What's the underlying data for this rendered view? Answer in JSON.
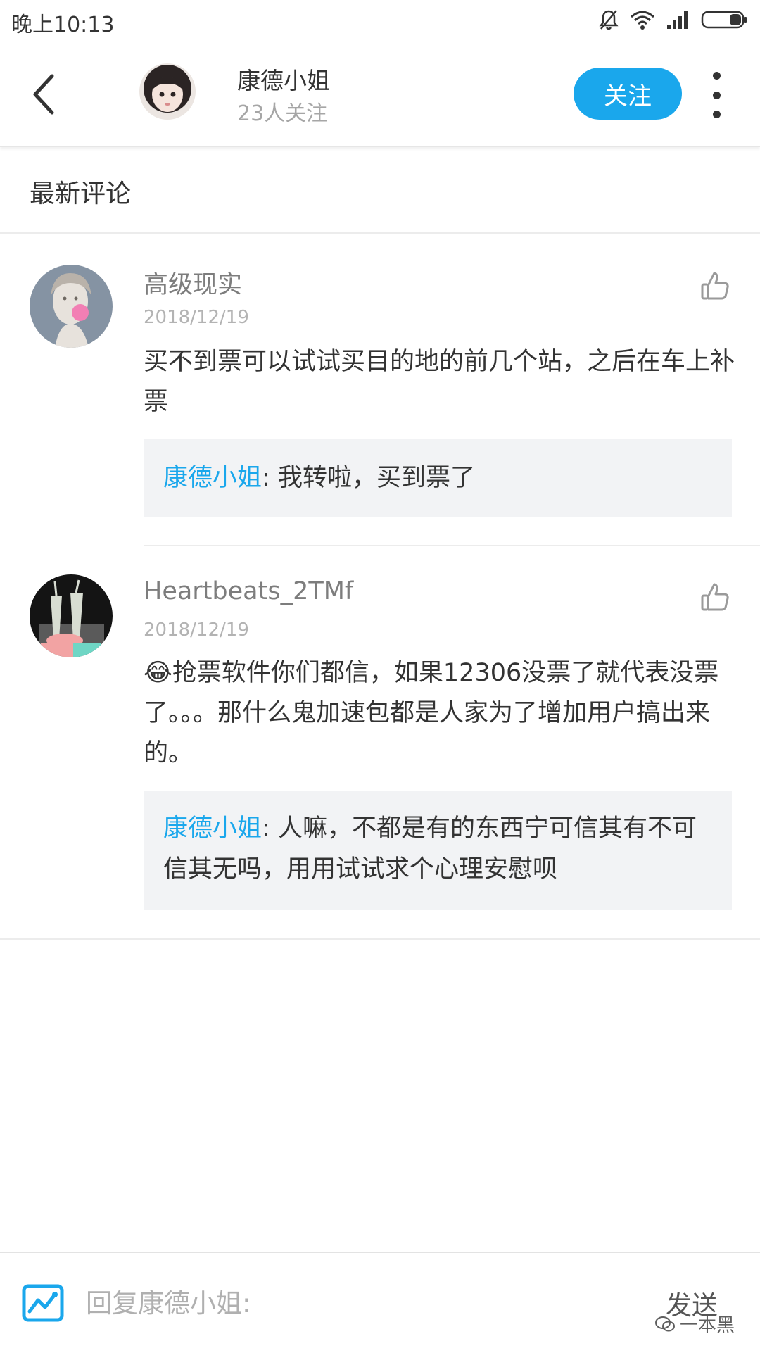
{
  "status_bar": {
    "time": "晚上10:13",
    "icons": [
      "mute-bell-icon",
      "wifi-icon",
      "signal-icon",
      "battery-icon"
    ]
  },
  "header": {
    "back_icon": "chevron-left-icon",
    "user_name": "康德小姐",
    "followers": "23人关注",
    "follow_label": "关注",
    "more_icon": "more-vertical-icon",
    "accent_color": "#1aa7ec"
  },
  "section": {
    "title": "最新评论"
  },
  "comments": [
    {
      "author": "高级现实",
      "date": "2018/12/19",
      "text": "买不到票可以试试买目的地的前几个站，之后在车上补票",
      "like_icon": "thumbs-up-icon",
      "reply": {
        "author": "康德小姐",
        "separator": ":",
        "text": " 我转啦，买到票了"
      }
    },
    {
      "author": "Heartbeats_2TMf",
      "date": "2018/12/19",
      "emoji": "😂",
      "text": "抢票软件你们都信，如果12306没票了就代表没票了。。。那什么鬼加速包都是人家为了增加用户搞出来的。",
      "like_icon": "thumbs-up-icon",
      "reply": {
        "author": "康德小姐",
        "separator": ":",
        "text": " 人嘛，不都是有的东西宁可信其有不可信其无吗，用用试试求个心理安慰呗"
      }
    }
  ],
  "bottom_bar": {
    "emoji_icon": "image-chart-icon",
    "input_placeholder": "回复康德小姐:",
    "input_value": "",
    "send_label": "发送",
    "watermark": "一本黑"
  }
}
